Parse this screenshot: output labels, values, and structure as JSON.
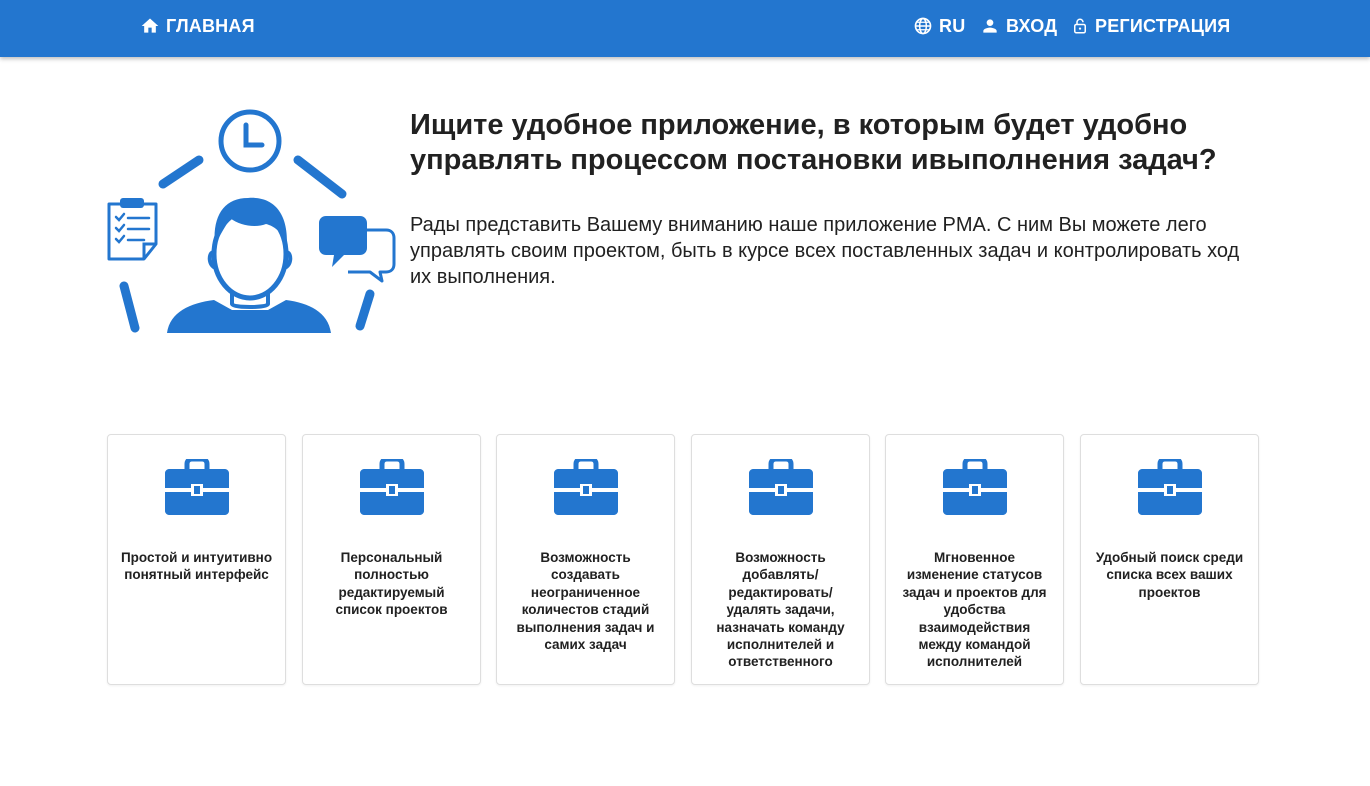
{
  "colors": {
    "accent": "#2376cf",
    "text": "#212121",
    "card_border": "#dedede"
  },
  "nav": {
    "home": {
      "label": "ГЛАВНАЯ",
      "icon": "home-icon"
    },
    "language": {
      "label": "RU",
      "icon": "globe-icon"
    },
    "login": {
      "label": "ВХОД",
      "icon": "person-icon"
    },
    "register": {
      "label": "РЕГИСТРАЦИЯ",
      "icon": "lock-open-icon"
    }
  },
  "hero": {
    "illustration": "project-management-illustration",
    "title": "Ищите удобное приложение, в которым будет удобно управлять процессом постановки ивыполнения задач?",
    "text": "Рады представить Вашему вниманию наше приложение PMA. С ним Вы можете лего управлять своим проектом, быть в курсе всех поставленных задач и контролировать ход их выполнения."
  },
  "features": [
    {
      "icon": "briefcase-icon",
      "text": "Простой и интуитивно понятный интерфейс"
    },
    {
      "icon": "briefcase-icon",
      "text": "Персональный полностью редактируемый список проектов"
    },
    {
      "icon": "briefcase-icon",
      "text": "Возможность создавать неограниченное количестов стадий выполнения задач и самих задач"
    },
    {
      "icon": "briefcase-icon",
      "text": "Возможность добавлять/ редактировать/ удалять задачи, назначать команду исполнителей и ответственного"
    },
    {
      "icon": "briefcase-icon",
      "text": "Мгновенное изменение статусов задач и проектов для удобства взаимодействия между командой исполнителей"
    },
    {
      "icon": "briefcase-icon",
      "text": "Удобный поиск среди списка всех ваших проектов"
    }
  ]
}
